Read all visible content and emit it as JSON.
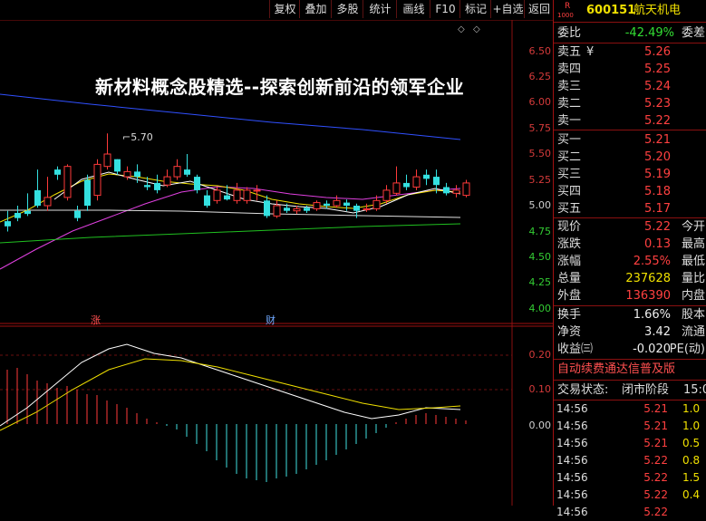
{
  "toolbar": {
    "buttons": [
      "复权",
      "叠加",
      "多股",
      "统计",
      "画线",
      "F10",
      "标记",
      "+自选",
      "返回"
    ]
  },
  "headline": "新材料概念股精选--探索创新前沿的领军企业",
  "chart": {
    "max_label": "5.70",
    "price_ticks": [
      "6.50",
      "6.25",
      "6.00",
      "5.75",
      "5.50",
      "5.25",
      "5.00",
      "4.75",
      "4.50",
      "4.25",
      "4.00"
    ],
    "markers": {
      "rise": "涨",
      "finance": "财"
    },
    "macd_ticks": [
      "0.20",
      "0.10",
      "0.00"
    ]
  },
  "quote": {
    "market_tag": "R",
    "market_sub": "1000",
    "code": "600151",
    "name": "航天机电",
    "weibi_label": "委比",
    "weibi_value": "-42.49%",
    "weicha_label": "委差",
    "asks": [
      {
        "label": "卖五",
        "extra": "¥",
        "price": "5.26"
      },
      {
        "label": "卖四",
        "price": "5.25"
      },
      {
        "label": "卖三",
        "price": "5.24"
      },
      {
        "label": "卖二",
        "price": "5.23"
      },
      {
        "label": "卖一",
        "price": "5.22"
      }
    ],
    "bids": [
      {
        "label": "买一",
        "price": "5.21"
      },
      {
        "label": "买二",
        "price": "5.20"
      },
      {
        "label": "买三",
        "price": "5.19"
      },
      {
        "label": "买四",
        "price": "5.18"
      },
      {
        "label": "买五",
        "price": "5.17"
      }
    ],
    "stats": [
      {
        "label": "现价",
        "value": "5.22",
        "label2": "今开",
        "color": "red"
      },
      {
        "label": "涨跌",
        "value": "0.13",
        "label2": "最高",
        "color": "red"
      },
      {
        "label": "涨幅",
        "value": "2.55%",
        "label2": "最低",
        "color": "red"
      },
      {
        "label": "总量",
        "value": "237628",
        "label2": "量比",
        "color": "yellow"
      },
      {
        "label": "外盘",
        "value": "136390",
        "label2": "内盘",
        "color": "red"
      }
    ],
    "stats2": [
      {
        "label": "换手",
        "value": "1.66%",
        "label2": "股本",
        "color": "white"
      },
      {
        "label": "净资",
        "value": "3.42",
        "label2": "流通",
        "color": "white"
      },
      {
        "label": "收益㈢",
        "value": "-0.020",
        "label2": "PE(动)",
        "color": "white"
      }
    ],
    "banner": "自动续费通达信普及版",
    "status_label": "交易状态:",
    "status_value": "闭市阶段",
    "status_time": "15:0",
    "trades": [
      {
        "time": "14:56",
        "price": "5.21",
        "vol": "1.0"
      },
      {
        "time": "14:56",
        "price": "5.21",
        "vol": "1.0"
      },
      {
        "time": "14:56",
        "price": "5.21",
        "vol": "0.5"
      },
      {
        "time": "14:56",
        "price": "5.22",
        "vol": "0.8"
      },
      {
        "time": "14:56",
        "price": "5.22",
        "vol": "1.5"
      },
      {
        "time": "14:56",
        "price": "5.22",
        "vol": "0.4"
      },
      {
        "time": "14:56",
        "price": "5.22",
        "vol": ""
      }
    ]
  }
}
